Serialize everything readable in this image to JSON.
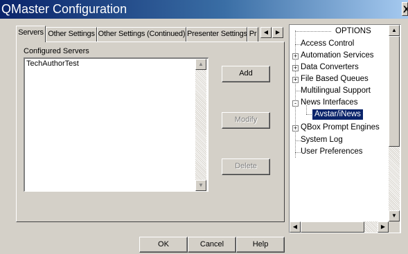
{
  "window": {
    "title": "QMaster Configuration",
    "close_glyph": "X"
  },
  "tabs": [
    {
      "label": "Servers",
      "active": true
    },
    {
      "label": "Other Settings",
      "active": false
    },
    {
      "label": "Other Settings (Continued)",
      "active": false
    },
    {
      "label": "Presenter Settings",
      "active": false
    },
    {
      "label": "Pr",
      "active": false
    }
  ],
  "servers": {
    "label": "Configured Servers",
    "items": [
      "TechAuthorTest"
    ],
    "add_label": "Add",
    "modify_label": "Modify",
    "delete_label": "Delete"
  },
  "dialog": {
    "ok_label": "OK",
    "cancel_label": "Cancel",
    "help_label": "Help"
  },
  "options_tree": {
    "title": "OPTIONS",
    "items": [
      {
        "label": "Access Control",
        "expander": null
      },
      {
        "label": "Automation Services",
        "expander": "+"
      },
      {
        "label": "Data Converters",
        "expander": "+"
      },
      {
        "label": "File Based Queues",
        "expander": "+"
      },
      {
        "label": "Multilingual Support",
        "expander": null
      },
      {
        "label": "News Interfaces",
        "expander": "-"
      },
      {
        "label": "Avstar/iNews",
        "expander": null,
        "selected": true,
        "child": true
      },
      {
        "label": "QBox Prompt Engines",
        "expander": "+"
      },
      {
        "label": "System Log",
        "expander": null
      },
      {
        "label": "User Preferences",
        "expander": null
      }
    ]
  },
  "colors": {
    "face": "#d4d0c8",
    "title_start": "#0a246a",
    "title_end": "#a6caf0",
    "selection": "#0a246a"
  }
}
